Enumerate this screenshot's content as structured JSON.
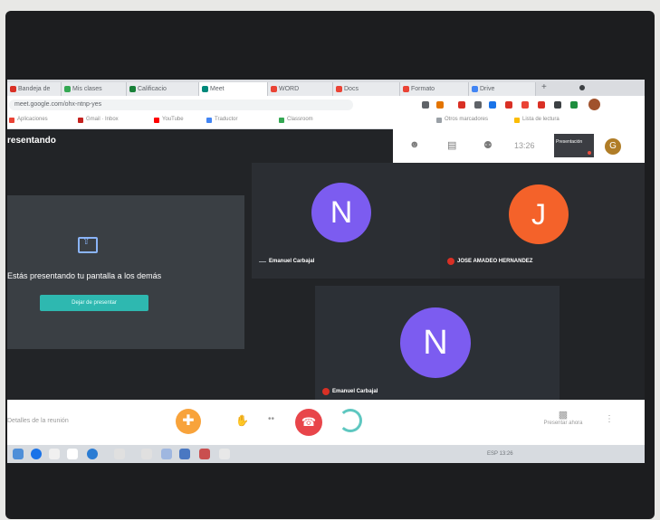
{
  "browser": {
    "tabs": [
      {
        "label": "Bandeja de",
        "color": "#d93025"
      },
      {
        "label": "Mis clases",
        "color": "#34a853"
      },
      {
        "label": "Calificacio",
        "color": "#188038"
      },
      {
        "label": "Meet",
        "color": "#00897b"
      },
      {
        "label": "WORD",
        "color": "#ea4335"
      },
      {
        "label": "Docs",
        "color": "#ea4335"
      },
      {
        "label": "Formato",
        "color": "#ea4335"
      },
      {
        "label": "Drive",
        "color": "#4285f4"
      }
    ],
    "new_tab_symbol": "+",
    "url": "meet.google.com/ohx-ntnp-yes",
    "bookmarks": [
      {
        "label": "Aplicaciones",
        "color": "#ea4335"
      },
      {
        "label": "Gmail · Inbox",
        "color": "#c5221f"
      },
      {
        "label": "YouTube",
        "color": "#ff0000"
      },
      {
        "label": "Traductor",
        "color": "#4285f4"
      },
      {
        "label": "Classroom",
        "color": "#34a853"
      },
      {
        "label": "Otros marcadores",
        "color": "#9aa0a6"
      },
      {
        "label": "Lista de lectura",
        "color": "#fbbc04"
      }
    ]
  },
  "meet": {
    "title": "resentando",
    "time": "13:26",
    "self_label": "Presentación",
    "my_initial": "G",
    "present": {
      "text": "Estás presentando tu pantalla a los demás",
      "stop_button": "Dejar de presentar"
    },
    "participants": [
      {
        "initial": "N",
        "name": "Emanuel Carbajal",
        "avatar_color": "#7c5cf0",
        "muted": false
      },
      {
        "initial": "J",
        "name": "JOSE AMADEO HERNANDEZ",
        "avatar_color": "#f4622a",
        "muted": true
      },
      {
        "initial": "N",
        "name": "Emanuel Carbajal",
        "avatar_color": "#7c5cf0",
        "muted": true
      }
    ],
    "controls": {
      "meeting_details": "Detalles de la reunión",
      "present_now": "Presentar ahora",
      "more_icon": "⋮"
    }
  },
  "taskbar": {
    "tray_text": "ESP  13:26"
  },
  "colors": {
    "hand_button": "#f8a33b",
    "hangup_button": "#e8454a",
    "loading_ring": "#5ec7c0"
  }
}
